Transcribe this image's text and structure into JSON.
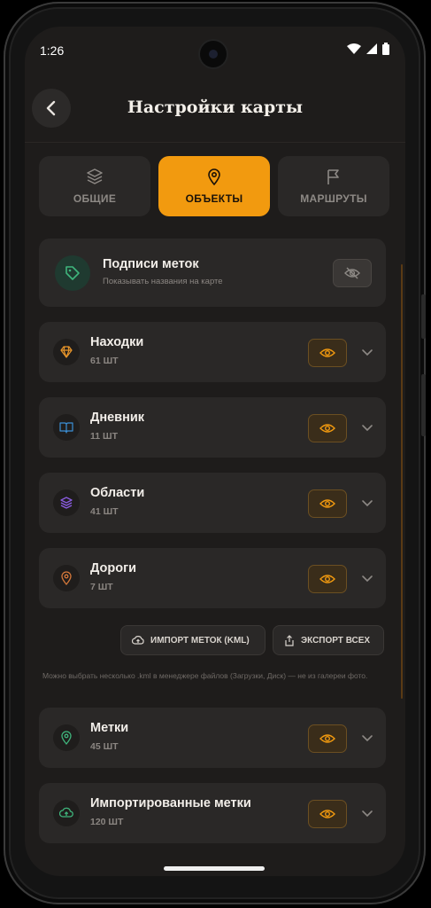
{
  "status": {
    "time": "1:26"
  },
  "header": {
    "title": "Настройки карты"
  },
  "tabs": [
    {
      "label": "ОБЩИЕ",
      "icon": "layers-icon"
    },
    {
      "label": "ОБЪЕКТЫ",
      "icon": "pin-icon",
      "active": true
    },
    {
      "label": "МАРШРУТЫ",
      "icon": "flag-icon"
    }
  ],
  "labels_card": {
    "title": "Подписи меток",
    "subtitle": "Показывать названия на карте",
    "icon": "tag-icon"
  },
  "categories": [
    {
      "name": "Находки",
      "count": "61 ШТ",
      "icon": "diamond-icon",
      "color": "#e8952a"
    },
    {
      "name": "Дневник",
      "count": "11 ШТ",
      "icon": "book-icon",
      "color": "#3b8fd6"
    },
    {
      "name": "Области",
      "count": "41 ШТ",
      "icon": "layers-icon",
      "color": "#8a5ce0"
    },
    {
      "name": "Дороги",
      "count": "7 ШТ",
      "icon": "pin-icon",
      "color": "#d6783a"
    }
  ],
  "actions": {
    "import": "ИМПОРТ МЕТОК (KML)",
    "export": "ЭКСПОРТ ВСЕХ"
  },
  "hint": "Можно выбрать несколько .kml в менеджере файлов (Загрузки, Диск) — не из галереи фото.",
  "categories2": [
    {
      "name": "Метки",
      "count": "45 ШТ",
      "icon": "pin-icon",
      "color": "#3fb57c"
    },
    {
      "name": "Импортированные метки",
      "count": "120 ШТ",
      "icon": "cloud-upload-icon",
      "color": "#3fb57c"
    }
  ],
  "colors": {
    "accent": "#f29a0f",
    "card": "#2a2827",
    "background": "#1e1c1b"
  }
}
